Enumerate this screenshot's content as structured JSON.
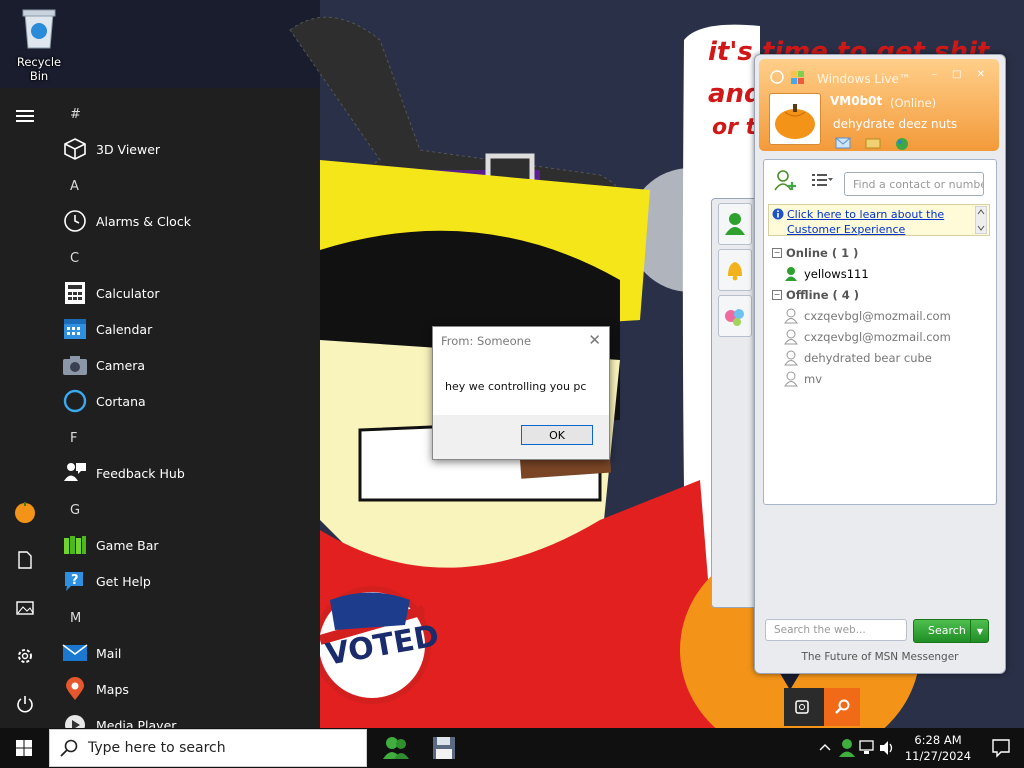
{
  "desktop": {
    "recycle_bin_label": "Recycle Bin",
    "wallpaper_text_line1": "it's time to get shit",
    "wallpaper_text_line2": "and",
    "wallpaper_text_line3": "or t",
    "voted_text": "VOTED"
  },
  "start_menu": {
    "groups": [
      {
        "letter": "#",
        "apps": [
          {
            "name": "3D Viewer",
            "icon": "cube-icon"
          }
        ]
      },
      {
        "letter": "A",
        "apps": [
          {
            "name": "Alarms & Clock",
            "icon": "clock-icon"
          }
        ]
      },
      {
        "letter": "C",
        "apps": [
          {
            "name": "Calculator",
            "icon": "calculator-icon"
          },
          {
            "name": "Calendar",
            "icon": "calendar-icon"
          },
          {
            "name": "Camera",
            "icon": "camera-icon"
          },
          {
            "name": "Cortana",
            "icon": "cortana-icon"
          }
        ]
      },
      {
        "letter": "F",
        "apps": [
          {
            "name": "Feedback Hub",
            "icon": "feedback-icon"
          }
        ]
      },
      {
        "letter": "G",
        "apps": [
          {
            "name": "Game Bar",
            "icon": "gamebar-icon"
          },
          {
            "name": "Get Help",
            "icon": "help-icon"
          }
        ]
      },
      {
        "letter": "M",
        "apps": [
          {
            "name": "Mail",
            "icon": "mail-icon"
          },
          {
            "name": "Maps",
            "icon": "map-pin-icon"
          },
          {
            "name": "Media Player",
            "icon": "play-icon"
          }
        ]
      }
    ]
  },
  "dialog": {
    "title": "From: Someone",
    "close_glyph": "✕",
    "message": "hey we controlling you pc",
    "ok_label": "OK"
  },
  "messenger": {
    "window_title": "Windows Live™",
    "window_buttons": "– □ ✕",
    "nickname": "VM0b0t",
    "status": "(Online)",
    "personal_message": "dehydrate deez nuts",
    "find_placeholder": "Find a contact or number",
    "banner_line1": "Click here to learn about the",
    "banner_line2": "Customer Experience",
    "online_group": "Online ( 1 )",
    "offline_group": "Offline ( 4 )",
    "online_contacts": [
      "yellows111"
    ],
    "offline_contacts": [
      "cxzqevbgl@mozmail.com",
      "cxzqevbgl@mozmail.com",
      "dehydrated bear cube",
      "mv"
    ],
    "web_search_placeholder": "Search the web...",
    "search_label": "Search",
    "footer": "The Future of MSN Messenger",
    "colors": {
      "header": "#f39a3a",
      "online": "#2ea02e",
      "offline": "#999999"
    }
  },
  "taskbar": {
    "search_placeholder": "Type here to search",
    "time": "6:28 AM",
    "date": "11/27/2024"
  }
}
